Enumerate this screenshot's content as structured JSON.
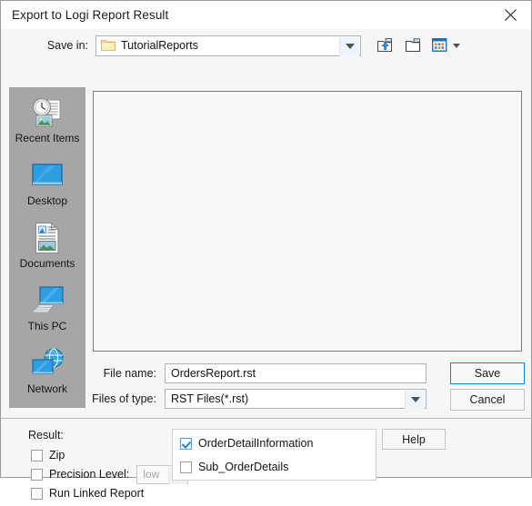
{
  "window": {
    "title": "Export to Logi Report Result",
    "close_icon": "close-icon"
  },
  "savein": {
    "label": "Save in:",
    "value": "TutorialReports",
    "folder_icon": "folder-icon",
    "dropdown_icon": "chevron-down-icon",
    "toolbar": {
      "up_one_level": "up-one-level-icon",
      "create_new_folder": "create-new-folder-icon",
      "view_menu": "view-menu-icon",
      "view_menu_arrow": "chevron-down-icon"
    }
  },
  "places": {
    "items": [
      {
        "label": "Recent Items",
        "icon": "recent-items-icon"
      },
      {
        "label": "Desktop",
        "icon": "desktop-icon"
      },
      {
        "label": "Documents",
        "icon": "documents-icon"
      },
      {
        "label": "This PC",
        "icon": "this-pc-icon"
      },
      {
        "label": "Network",
        "icon": "network-icon"
      }
    ]
  },
  "filelist": {
    "items": []
  },
  "fields": {
    "filename_label": "File name:",
    "filename_value": "OrdersReport.rst",
    "filetype_label": "Files of type:",
    "filetype_value": "RST Files(*.rst)",
    "filetype_dropdown_icon": "chevron-down-icon"
  },
  "buttons": {
    "save": "Save",
    "cancel": "Cancel",
    "help": "Help"
  },
  "result": {
    "title": "Result:",
    "options": [
      {
        "label": "Zip",
        "checked": false
      },
      {
        "label": "Precision Level:",
        "checked": false
      },
      {
        "label": "Run Linked Report",
        "checked": false
      }
    ],
    "precision_value": "low",
    "precision_dropdown_icon": "chevron-down-icon"
  },
  "datasources": {
    "items": [
      {
        "label": "OrderDetailInformation",
        "checked": true
      },
      {
        "label": "Sub_OrderDetails",
        "checked": false
      }
    ]
  },
  "colors": {
    "accent": "#0f82d8",
    "check": "#2a7fd4",
    "places_bg": "#a6a6a6",
    "dialog_bg": "#f5f6f5"
  }
}
